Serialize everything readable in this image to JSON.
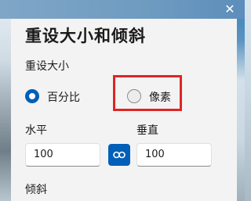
{
  "dialog": {
    "title": "重设大小和倾斜",
    "close_glyph": "✕",
    "resize_section_label": "重设大小",
    "options": [
      {
        "label": "百分比",
        "checked": true
      },
      {
        "label": "像素",
        "checked": false
      }
    ],
    "horizontal_label": "水平",
    "vertical_label": "垂直",
    "horizontal_value": "100",
    "vertical_value": "100",
    "skew_section_label": "倾斜",
    "accent_color": "#005fb8",
    "highlight_color": "#e02424"
  }
}
